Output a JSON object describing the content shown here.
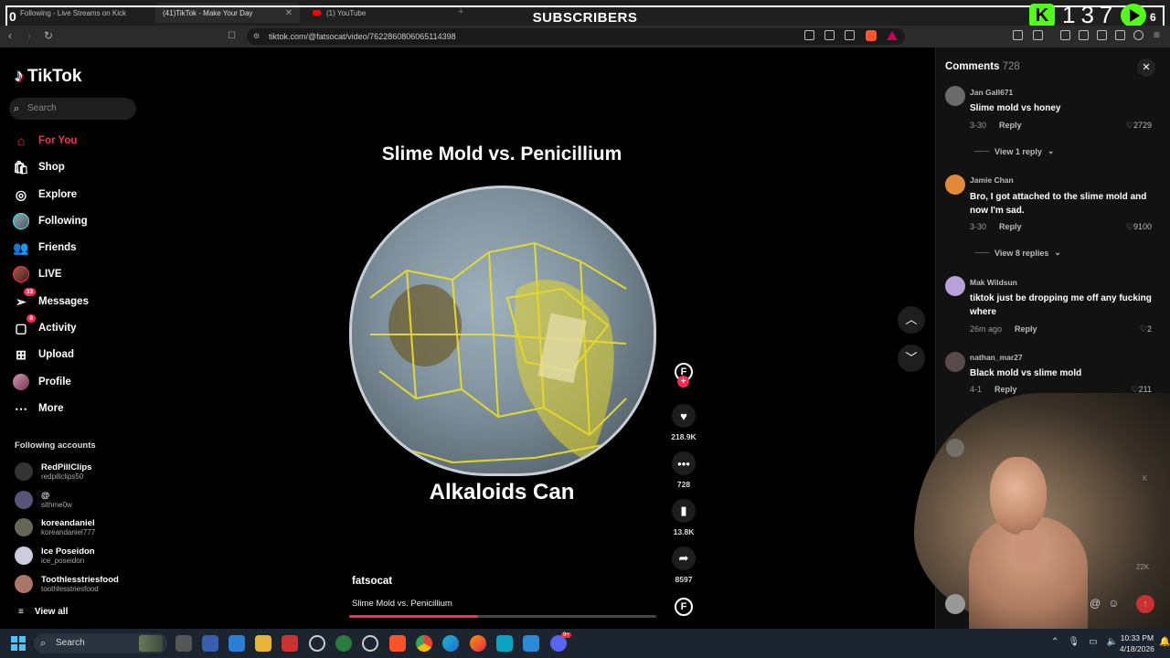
{
  "browser": {
    "tabs": [
      {
        "label": "Following - Live Streams on Kick",
        "active": false
      },
      {
        "label": "(41)TikTok - Make Your Day",
        "active": true
      },
      {
        "label": "(1) YouTube",
        "active": false
      }
    ],
    "url": "tiktok.com/@fatsocat/video/7622860806065114398"
  },
  "overlay": {
    "subscribers_label": "SUBSCRIBERS",
    "left_count": "0",
    "kick_letter": "K",
    "subscriber_count": "137",
    "right_count": "6"
  },
  "sidebar": {
    "brand": "TikTok",
    "search_placeholder": "Search",
    "nav": [
      {
        "label": "For You",
        "icon": "home-icon",
        "active": true
      },
      {
        "label": "Shop",
        "icon": "shop-bag-icon"
      },
      {
        "label": "Explore",
        "icon": "compass-icon"
      },
      {
        "label": "Following",
        "icon": "avatar"
      },
      {
        "label": "Friends",
        "icon": "friends-icon"
      },
      {
        "label": "LIVE",
        "icon": "live-avatar"
      },
      {
        "label": "Messages",
        "icon": "paper-plane-icon",
        "badge": "33"
      },
      {
        "label": "Activity",
        "icon": "activity-icon",
        "badge": "8"
      },
      {
        "label": "Upload",
        "icon": "plus-square-icon"
      },
      {
        "label": "Profile",
        "icon": "avatar"
      },
      {
        "label": "More",
        "icon": "dots-icon"
      }
    ],
    "following_title": "Following accounts",
    "accounts": [
      {
        "name": "RedPillClips",
        "handle": "redpillclips50"
      },
      {
        "name": "@",
        "handle": "sithme0w"
      },
      {
        "name": "koreandaniel",
        "handle": "koreandaniel777"
      },
      {
        "name": "Ice Poseidon",
        "handle": "ice_poseidon"
      },
      {
        "name": "Toothlesstriesfood",
        "handle": "toothlesstriesfood"
      }
    ],
    "view_all": "View all"
  },
  "video": {
    "title": "Slime Mold vs. Penicillium",
    "caption": "Alkaloids Can",
    "author": "fatsocat",
    "description": "Slime Mold vs. Penicillium",
    "progress_fraction": 0.42,
    "actions": {
      "likes": "218.9K",
      "comments": "728",
      "saves": "13.8K",
      "shares": "8597"
    }
  },
  "comments": {
    "title": "Comments",
    "count": "728",
    "items": [
      {
        "user": "Jan Gall671",
        "text": "Slime mold vs honey",
        "date": "3-30",
        "likes": "2729",
        "replies": "View 1 reply"
      },
      {
        "user": "Jamie  Chan",
        "text": "Bro, I got attached to the slime mold and now I'm sad.",
        "date": "3-30",
        "likes": "9100",
        "replies": "View 8 replies"
      },
      {
        "user": "Mak Wildsun",
        "text": "tiktok just be dropping me off any fucking where",
        "date": "26m ago",
        "likes": "2"
      },
      {
        "user": "nathan_mar27",
        "text": "Black mold vs slime mold",
        "date": "4-1",
        "likes": "211"
      }
    ],
    "reply_label": "Reply",
    "partial_likes": [
      "K",
      "22K"
    ]
  },
  "taskbar": {
    "search_label": "Search",
    "time": "10:33 PM",
    "date": "4/18/2026",
    "discord_badge": "9+"
  }
}
